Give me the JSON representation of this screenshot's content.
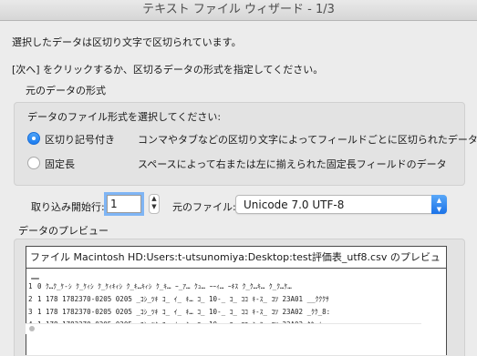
{
  "window": {
    "title": "テキスト ファイル ウィザード - 1/3"
  },
  "intro": {
    "line1": "選択したデータは区切り文字で区切られています。",
    "line2": "[次へ] をクリックするか、区切るデータの形式を指定してください。"
  },
  "format_group": {
    "heading": "元のデータの形式",
    "prompt": "データのファイル形式を選択してください:",
    "options": [
      {
        "label": "区切り記号付き",
        "description": "コンマやタブなどの区切り文字によってフィールドごとに区切られたデータ",
        "selected": true
      },
      {
        "label": "固定長",
        "description": "スペースによって右または左に揃えられた固定長フィールドのデータ",
        "selected": false
      }
    ]
  },
  "import": {
    "start_row_label": "取り込み開始行:",
    "start_row_value": "1",
    "origin_label": "元のファイル:",
    "origin_value": "Unicode 7.0 UTF-8"
  },
  "preview": {
    "heading": "データのプレビュー",
    "title": "ファイル Macintosh HD:Users:t-utsunomiya:Desktop:test評価表_utf8.csv のプレビュー",
    "rows": [
      {
        "num": "1",
        "text": "0 ｸ…ｸ_ｹ‐ｼ ｸ_ｹｨｼ ｸ_ｹｨｷｨｼ ｸ_ｷ…ｷｨｼ ｸ_ｷ… ｰ_ｱ… ｸｭ… ｰｰｨ… ｰｷｽ ｸ_ｸ…ｷ… ｸ_ｸ…ｹ…"
      },
      {
        "num": "2",
        "text": "1 178 1782370-0205 0205 _ｺｼ_ﾂｷ ｺ_ ｲ_ ｷ… ｺ_ 10-_ ｺ_ ｺｺ ｷ-ｽ_ ｺﾂ 23A01 __ｸｸｸｻ"
      },
      {
        "num": "3",
        "text": "1 178 1782370-0205 0205 _ｺｼ_ﾂｷ ｺ_ ｲ_ ｷ… ｺ_ 10-_ ｺ_ ｺｺ ｷ-ｽ_ ｺﾂ 23A02 _ｸｸ_8:"
      },
      {
        "num": "4",
        "text": "1 178 1782370-0205 0205 _ｺｼ_ﾂｷ ｺ_ ｲ_ ｷ… ｺ_ 10-_ ｺ_ ｺｺ ｷ-ｽ_ ｺﾂ 23A03 ｸｸ_ｲ…"
      }
    ]
  },
  "icons": {
    "stepper": "stepper-icon",
    "select_arrows": "chevron-up-down-icon"
  },
  "colors": {
    "accent": "#1b7cf0",
    "focus_ring": "#7fb5f5",
    "window_bg": "#ececec"
  }
}
